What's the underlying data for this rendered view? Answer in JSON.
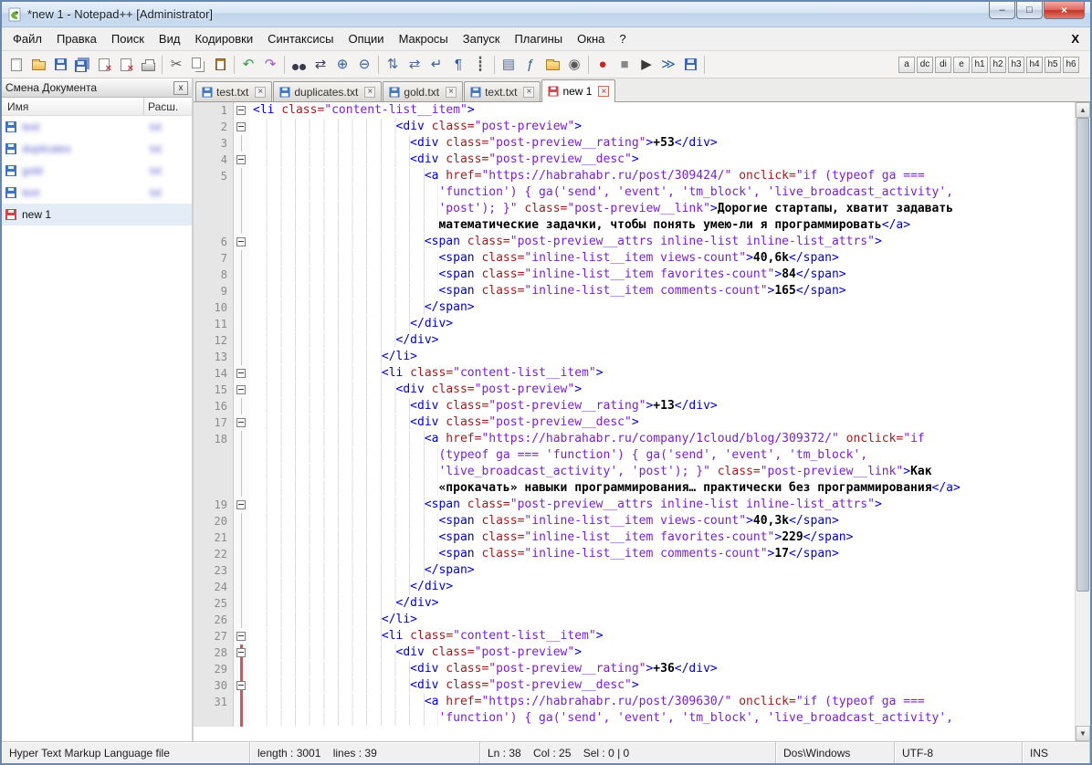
{
  "window": {
    "title": "*new 1 - Notepad++ [Administrator]",
    "controls": {
      "minimize": "–",
      "maximize": "□",
      "close": "×"
    }
  },
  "menu": {
    "items": [
      {
        "id": "file",
        "label": "Файл"
      },
      {
        "id": "edit",
        "label": "Правка"
      },
      {
        "id": "search",
        "label": "Поиск"
      },
      {
        "id": "view",
        "label": "Вид"
      },
      {
        "id": "encoding",
        "label": "Кодировки"
      },
      {
        "id": "language",
        "label": "Синтаксисы"
      },
      {
        "id": "settings",
        "label": "Опции"
      },
      {
        "id": "macro",
        "label": "Макросы"
      },
      {
        "id": "run",
        "label": "Запуск"
      },
      {
        "id": "plugins",
        "label": "Плагины"
      },
      {
        "id": "window",
        "label": "Окна"
      },
      {
        "id": "help",
        "label": "?"
      }
    ],
    "close_label": "X"
  },
  "toolbar": {
    "items": [
      {
        "id": "new-file",
        "shape": "page"
      },
      {
        "id": "open-folder",
        "shape": "folder"
      },
      {
        "id": "save",
        "shape": "floppy"
      },
      {
        "id": "save-all",
        "shape": "floppy-multi"
      },
      {
        "id": "close-doc",
        "shape": "page-x"
      },
      {
        "id": "close-all-docs",
        "shape": "page-xx"
      },
      {
        "id": "print",
        "shape": "printer"
      },
      {
        "id": "sep"
      },
      {
        "id": "cut",
        "glyph": "✂",
        "color": "#5a5a5a"
      },
      {
        "id": "copy",
        "shape": "copy"
      },
      {
        "id": "paste",
        "shape": "clipboard"
      },
      {
        "id": "sep"
      },
      {
        "id": "undo",
        "glyph": "↶",
        "color": "#2e9e3e"
      },
      {
        "id": "redo",
        "glyph": "↷",
        "color": "#9e5abf"
      },
      {
        "id": "sep"
      },
      {
        "id": "find",
        "shape": "binoculars"
      },
      {
        "id": "replace",
        "glyph": "⇄",
        "color": "#3a3a6a"
      },
      {
        "id": "zoom-in",
        "glyph": "⊕",
        "color": "#2e5fa3"
      },
      {
        "id": "zoom-out",
        "glyph": "⊖",
        "color": "#2e5fa3"
      },
      {
        "id": "sep"
      },
      {
        "id": "sync-scroll-vertical",
        "glyph": "⇅",
        "color": "#4a6a9a"
      },
      {
        "id": "sync-scroll-horizontal",
        "glyph": "⇄",
        "color": "#4a6a9a"
      },
      {
        "id": "word-wrap",
        "glyph": "↵",
        "color": "#2e5fa3"
      },
      {
        "id": "show-all-characters",
        "glyph": "¶",
        "color": "#2e5fa3"
      },
      {
        "id": "indent-guide",
        "glyph": "┋",
        "color": "#5a5a5a"
      },
      {
        "id": "sep"
      },
      {
        "id": "document-map",
        "glyph": "▤",
        "color": "#4a6a9a"
      },
      {
        "id": "function-list",
        "glyph": "ƒ",
        "color": "#2e5fa3"
      },
      {
        "id": "folder-as-workspace",
        "shape": "folder"
      },
      {
        "id": "monitoring",
        "glyph": "◉",
        "color": "#5a5a5a"
      },
      {
        "id": "sep"
      },
      {
        "id": "record-macro",
        "glyph": "●",
        "color": "#cc2222"
      },
      {
        "id": "stop-macro",
        "glyph": "■",
        "color": "#8a8a8a"
      },
      {
        "id": "play-macro",
        "glyph": "▶",
        "color": "#3a3a3a"
      },
      {
        "id": "playback-multiple",
        "glyph": "≫",
        "color": "#2e5fa3"
      },
      {
        "id": "save-macro",
        "shape": "floppy"
      },
      {
        "id": "sep"
      }
    ],
    "letter_buttons": [
      "a",
      "dc",
      "di",
      "e",
      "h1",
      "h2",
      "h3",
      "h4",
      "h5",
      "h6"
    ]
  },
  "doc_switcher": {
    "title": "Смена Документа",
    "close_label": "x",
    "columns": [
      "Имя",
      "Расш."
    ],
    "files": [
      {
        "name": "test",
        "ext": "txt",
        "blurred": true
      },
      {
        "name": "duplicates",
        "ext": "txt",
        "blurred": true
      },
      {
        "name": "gold",
        "ext": "txt",
        "blurred": true
      },
      {
        "name": "text",
        "ext": "txt",
        "blurred": true
      },
      {
        "name": "new 1",
        "ext": "",
        "selected": true,
        "unsaved": true
      }
    ]
  },
  "tab_close_glyph": "×",
  "tabs": [
    {
      "label": "test.txt"
    },
    {
      "label": "duplicates.txt"
    },
    {
      "label": "gold.txt"
    },
    {
      "label": "text.txt"
    },
    {
      "label": "new 1",
      "active": true,
      "unsaved": true
    }
  ],
  "editor": {
    "rows": [
      {
        "n": "1",
        "f": "box",
        "i": 0,
        "t": "<li class=\"content-list__item\">"
      },
      {
        "n": "2",
        "f": "box",
        "i": 20,
        "t": "<div class=\"post-preview\">"
      },
      {
        "n": "3",
        "f": "line",
        "i": 22,
        "t": "<div class=\"post-preview__rating\">+53</div>"
      },
      {
        "n": "4",
        "f": "box",
        "i": 22,
        "t": "<div class=\"post-preview__desc\">"
      },
      {
        "n": "5",
        "f": "line",
        "i": 24,
        "t": "<a href=\"https://habrahabr.ru/post/309424/\" onclick=\"if (typeof ga ==="
      },
      {
        "n": "",
        "f": "line",
        "i": 26,
        "t": "'function') { ga('send', 'event', 'tm_block', 'live_broadcast_activity',"
      },
      {
        "n": "",
        "f": "line",
        "i": 26,
        "t": "'post'); }\" class=\"post-preview__link\">Дорогие стартапы, хватит задавать"
      },
      {
        "n": "",
        "f": "line",
        "i": 26,
        "t": "математические задачки, чтобы понять умею-ли я программировать</a>"
      },
      {
        "n": "6",
        "f": "box",
        "i": 24,
        "t": "<span class=\"post-preview__attrs inline-list inline-list_attrs\">"
      },
      {
        "n": "7",
        "f": "line",
        "i": 26,
        "t": "<span class=\"inline-list__item views-count\">40,6k</span>"
      },
      {
        "n": "8",
        "f": "line",
        "i": 26,
        "t": "<span class=\"inline-list__item favorites-count\">84</span>"
      },
      {
        "n": "9",
        "f": "line",
        "i": 26,
        "t": "<span class=\"inline-list__item comments-count\">165</span>"
      },
      {
        "n": "10",
        "f": "line",
        "i": 24,
        "t": "</span>"
      },
      {
        "n": "11",
        "f": "line",
        "i": 22,
        "t": "</div>"
      },
      {
        "n": "12",
        "f": "line",
        "i": 20,
        "t": "</div>"
      },
      {
        "n": "13",
        "f": "line",
        "i": 18,
        "t": "</li>"
      },
      {
        "n": "14",
        "f": "box",
        "i": 18,
        "t": "<li class=\"content-list__item\">"
      },
      {
        "n": "15",
        "f": "box",
        "i": 20,
        "t": "<div class=\"post-preview\">"
      },
      {
        "n": "16",
        "f": "line",
        "i": 22,
        "t": "<div class=\"post-preview__rating\">+13</div>"
      },
      {
        "n": "17",
        "f": "box",
        "i": 22,
        "t": "<div class=\"post-preview__desc\">"
      },
      {
        "n": "18",
        "f": "line",
        "i": 24,
        "t": "<a href=\"https://habrahabr.ru/company/1cloud/blog/309372/\" onclick=\"if"
      },
      {
        "n": "",
        "f": "line",
        "i": 26,
        "t": "(typeof ga === 'function') { ga('send', 'event', 'tm_block',"
      },
      {
        "n": "",
        "f": "line",
        "i": 26,
        "t": "'live_broadcast_activity', 'post'); }\" class=\"post-preview__link\">Как"
      },
      {
        "n": "",
        "f": "line",
        "i": 26,
        "t": "«прокачать» навыки программирования… практически без программирования</a>"
      },
      {
        "n": "19",
        "f": "box",
        "i": 24,
        "t": "<span class=\"post-preview__attrs inline-list inline-list_attrs\">"
      },
      {
        "n": "20",
        "f": "line",
        "i": 26,
        "t": "<span class=\"inline-list__item views-count\">40,3k</span>"
      },
      {
        "n": "21",
        "f": "line",
        "i": 26,
        "t": "<span class=\"inline-list__item favorites-count\">229</span>"
      },
      {
        "n": "22",
        "f": "line",
        "i": 26,
        "t": "<span class=\"inline-list__item comments-count\">17</span>"
      },
      {
        "n": "23",
        "f": "line",
        "i": 24,
        "t": "</span>"
      },
      {
        "n": "24",
        "f": "line",
        "i": 22,
        "t": "</div>"
      },
      {
        "n": "25",
        "f": "line",
        "i": 20,
        "t": "</div>"
      },
      {
        "n": "26",
        "f": "line",
        "i": 18,
        "t": "</li>"
      },
      {
        "n": "27",
        "f": "box",
        "i": 18,
        "t": "<li class=\"content-list__item\">"
      },
      {
        "n": "28",
        "f": "boxred",
        "i": 20,
        "t": "<div class=\"post-preview\">"
      },
      {
        "n": "29",
        "f": "redline",
        "i": 22,
        "t": "<div class=\"post-preview__rating\">+36</div>"
      },
      {
        "n": "30",
        "f": "boxred",
        "i": 22,
        "t": "<div class=\"post-preview__desc\">"
      },
      {
        "n": "31",
        "f": "redline",
        "i": 24,
        "t": "<a href=\"https://habrahabr.ru/post/309630/\" onclick=\"if (typeof ga ==="
      },
      {
        "n": "",
        "f": "redline",
        "i": 26,
        "t": "'function') { ga('send', 'event', 'tm_block', 'live_broadcast_activity',"
      }
    ]
  },
  "scrollbar": {
    "up": "▲",
    "down": "▼"
  },
  "status_bar": {
    "doc_type": "Hyper Text Markup Language file",
    "length_info": "length : 3001    lines : 39",
    "cursor_info": "Ln : 38    Col : 25    Sel : 0 | 0",
    "eol_format": "Dos\\Windows",
    "encoding": "UTF-8",
    "typing_mode": "INS"
  }
}
